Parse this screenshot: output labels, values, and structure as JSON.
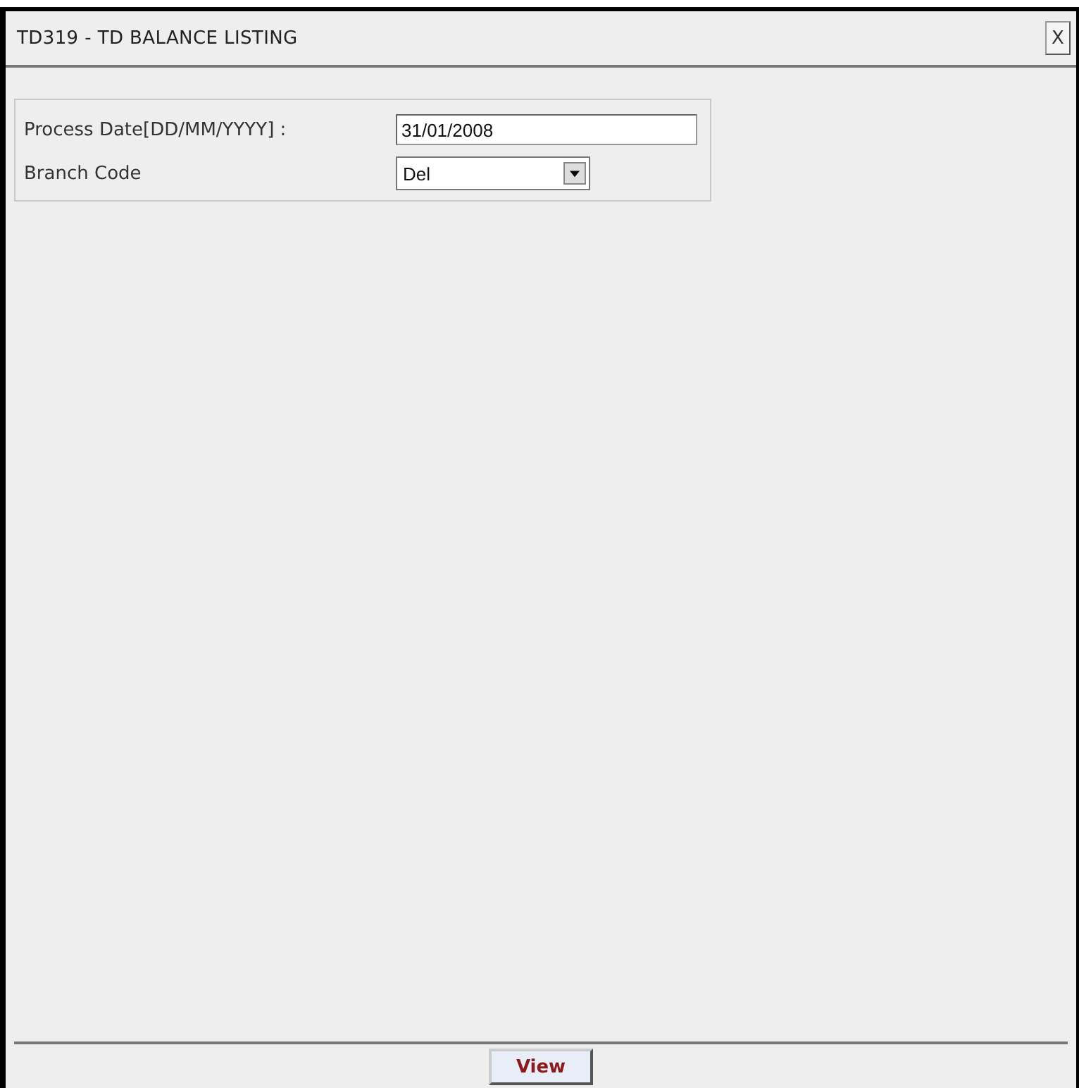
{
  "window": {
    "title": "TD319 - TD BALANCE LISTING",
    "close": "X"
  },
  "form": {
    "fields": [
      {
        "kind": "text",
        "label": "Process Date[DD/MM/YYYY] :",
        "value": "31/01/2008"
      },
      {
        "kind": "select",
        "label": "Branch Code",
        "value": "Del"
      }
    ]
  },
  "buttons": [
    "View"
  ]
}
